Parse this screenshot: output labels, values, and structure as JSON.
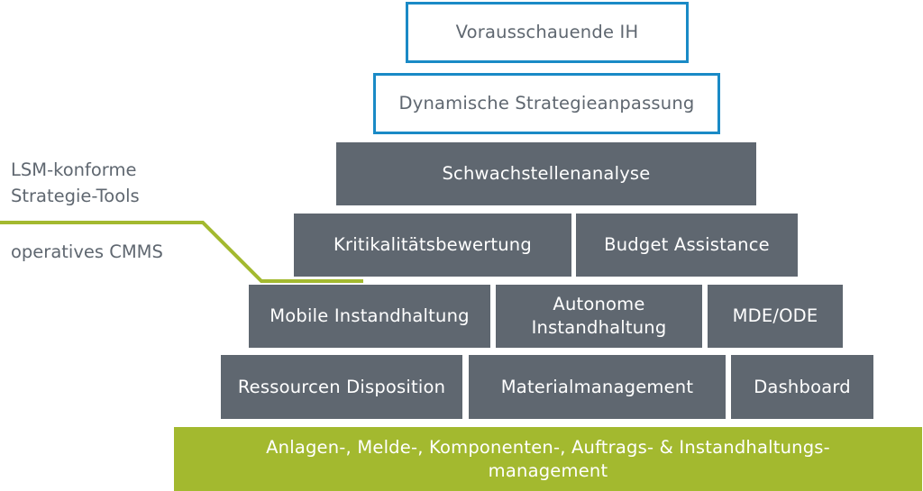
{
  "left_labels": {
    "upper_line1": "LSM-konforme",
    "upper_line2": "Strategie-Tools",
    "lower": "operatives CMMS"
  },
  "pyramid": {
    "level1": "Vorausschauende IH",
    "level2": "Dynamische Strategieanpassung",
    "level3": "Schwachstellenanalyse",
    "level4": [
      "Kritikalitätsbewertung",
      "Budget Assistance"
    ],
    "level5": [
      "Mobile Instandhaltung",
      "Autonome Instandhaltung",
      "MDE/ODE"
    ],
    "level6": [
      "Ressourcen Disposition",
      "Materialmanagement",
      "Dashboard"
    ],
    "base": "Anlagen-, Melde-, Komponenten-, Auftrags- & Instandhaltungs-management"
  },
  "colors": {
    "grey": "#5f6770",
    "green": "#a3b92f",
    "blue_outline": "#1a8ac6"
  }
}
